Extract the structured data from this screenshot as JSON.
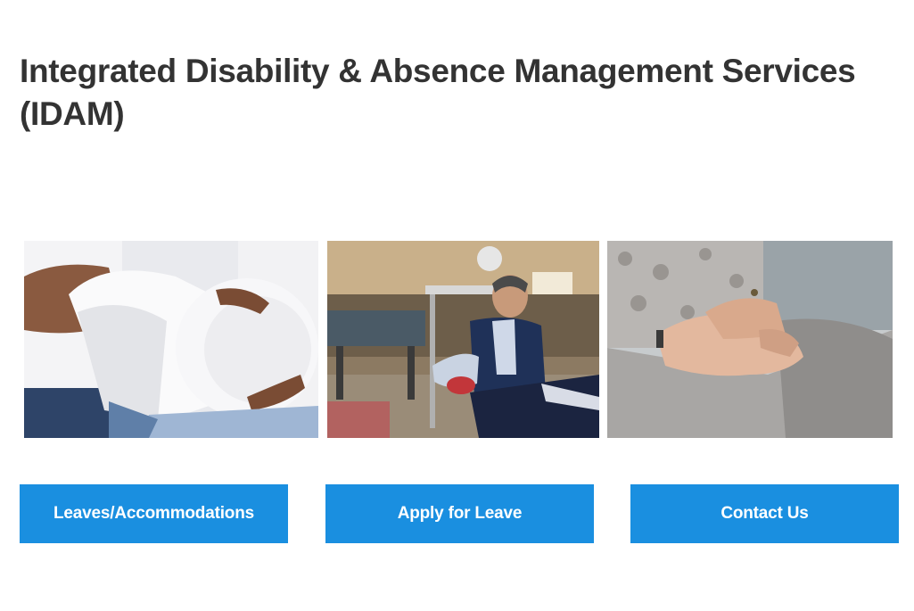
{
  "page": {
    "title": "Integrated Disability & Absence Management Services (IDAM)"
  },
  "tiles": [
    {
      "image": "pregnant-woman-photo",
      "button_label": "Leaves/Accommodations"
    },
    {
      "image": "injured-worker-photo",
      "button_label": "Apply for Leave"
    },
    {
      "image": "holding-hands-photo",
      "button_label": "Contact Us"
    }
  ],
  "colors": {
    "button_bg": "#1a8fe0",
    "button_text": "#ffffff",
    "title_text": "#333333"
  }
}
